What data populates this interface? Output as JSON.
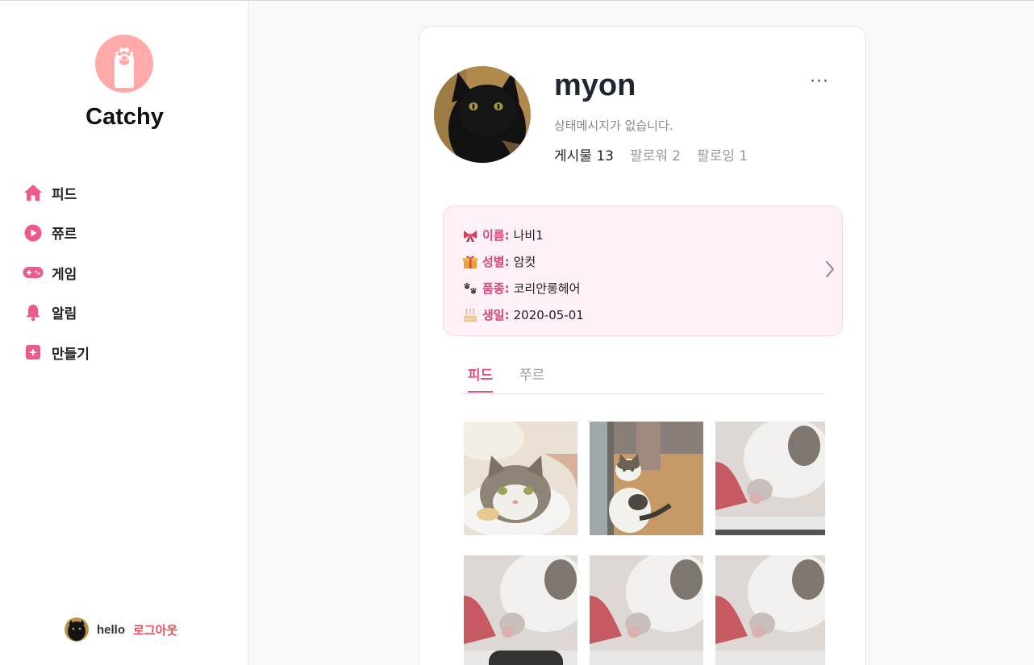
{
  "app": {
    "brand": "Catchy",
    "accent": "#e24d84",
    "logo_bg": "#ffa9a9"
  },
  "sidebar": {
    "items": [
      {
        "label": "피드",
        "icon": "home-icon"
      },
      {
        "label": "쮸르",
        "icon": "play-icon"
      },
      {
        "label": "게임",
        "icon": "gamepad-icon"
      },
      {
        "label": "알림",
        "icon": "bell-icon"
      },
      {
        "label": "만들기",
        "icon": "plus-square-icon"
      }
    ],
    "current_user": "hello",
    "logout": "로그아웃"
  },
  "profile": {
    "username": "myon",
    "more": "···",
    "status": "상태메시지가 없습니다.",
    "posts": "게시물 13",
    "followers": "팔로워 2",
    "following": "팔로잉 1"
  },
  "pet_info": {
    "name_label": "이름:",
    "name": "나비1",
    "gender_label": "성별:",
    "gender": "암컷",
    "breed_label": "품종:",
    "breed": "코리안롱헤어",
    "birthday_label": "생일:",
    "birthday": "2020-05-01"
  },
  "tabs": {
    "feed": "피드",
    "shorts": "쭈르"
  }
}
